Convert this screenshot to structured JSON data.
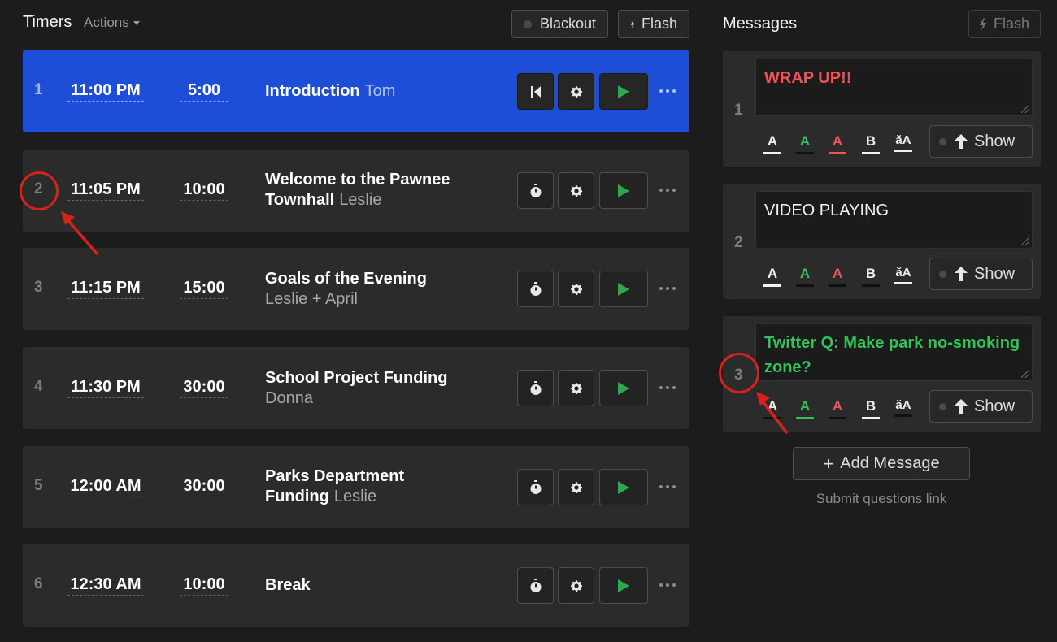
{
  "timers_header": {
    "title": "Timers",
    "actions_label": "Actions",
    "blackout_label": "Blackout",
    "flash_label": "Flash"
  },
  "timers": [
    {
      "index": "1",
      "start": "11:00 PM",
      "duration": "5:00",
      "title": "Introduction",
      "speaker": "Tom",
      "active": true
    },
    {
      "index": "2",
      "start": "11:05 PM",
      "duration": "10:00",
      "title": "Welcome to the Pawnee Townhall",
      "speaker": "Leslie",
      "active": false
    },
    {
      "index": "3",
      "start": "11:15 PM",
      "duration": "15:00",
      "title": "Goals of the Evening",
      "speaker": "Leslie + April",
      "active": false
    },
    {
      "index": "4",
      "start": "11:30 PM",
      "duration": "30:00",
      "title": "School Project Funding",
      "speaker": "Donna",
      "active": false
    },
    {
      "index": "5",
      "start": "12:00 AM",
      "duration": "30:00",
      "title": "Parks Department Funding",
      "speaker": "Leslie",
      "active": false
    },
    {
      "index": "6",
      "start": "12:30 AM",
      "duration": "10:00",
      "title": "Break",
      "speaker": "",
      "active": false
    }
  ],
  "messages_header": {
    "title": "Messages",
    "flash_label": "Flash"
  },
  "messages": [
    {
      "index": "1",
      "text": "WRAP UP!!",
      "color": "#f0525a"
    },
    {
      "index": "2",
      "text": "VIDEO PLAYING",
      "color": "#f1f1f1"
    },
    {
      "index": "3",
      "text": "Twitter Q: Make park no-smoking zone?",
      "color": "#33c15a"
    }
  ],
  "format_labels": {
    "a": "A",
    "b": "B",
    "aa": "ăA"
  },
  "show_label": "Show",
  "add_message_label": "Add Message",
  "submit_link_label": "Submit questions link",
  "colors": {
    "active_row": "#1e4ed8",
    "play_green": "#2ea84f",
    "annotation_red": "#d4231d"
  }
}
